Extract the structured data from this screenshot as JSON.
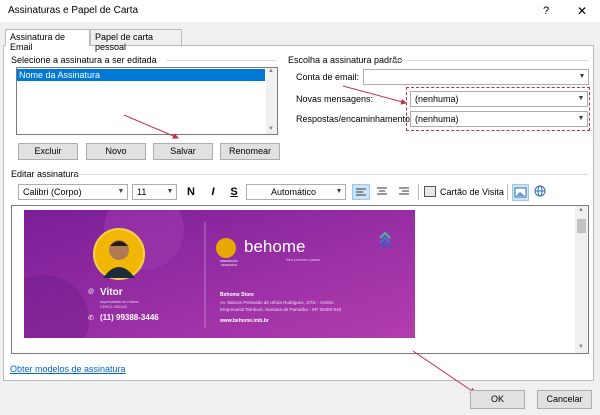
{
  "window": {
    "title": "Assinaturas e Papel de Carta",
    "help": "?",
    "close": "✕"
  },
  "tabs": [
    {
      "label": "Assinatura de Email"
    },
    {
      "label": "Papel de carta pessoal"
    }
  ],
  "left_group": {
    "label": "Selecione a assinatura a ser editada",
    "items": [
      "Nome da Assinatura"
    ],
    "buttons": {
      "delete": "Excluir",
      "new": "Novo",
      "save": "Salvar",
      "rename": "Renomear"
    }
  },
  "right_group": {
    "label": "Escolha a assinatura padrão",
    "account_label": "Conta de email:",
    "account_value": "",
    "new_messages_label": "Novas mensagens:",
    "new_messages_value": "(nenhuma)",
    "replies_label": "Respostas/encaminhamentos:",
    "replies_value": "(nenhuma)"
  },
  "editor": {
    "label": "Editar assinatura",
    "font": "Calibri (Corpo)",
    "size": "11",
    "bold": "N",
    "italic": "I",
    "underline": "S",
    "color": "Automático",
    "business_card": "Cartão de Visita"
  },
  "signature": {
    "name": "Vitor",
    "subtitle": "especialista em home",
    "subtitle2": "CRECI 202442",
    "phone": "(11) 99388-3446",
    "brand": "behome",
    "brand_tagline": "Seu próximo passo",
    "badge": "PREMIAÇÃO DIAMANTE",
    "company": "Behome Store",
    "address1": "Av. Marcos Penteado de Ulhôa Rodrigues, 3701 - Centro",
    "address2": "Empresarial Tamboré, Santana de Parnaíba - SP, 06460-040",
    "website": "www.behome.imb.br"
  },
  "footer": {
    "templates_link": "Obter modelos de assinatura",
    "ok": "OK",
    "cancel": "Cancelar"
  },
  "colors": {
    "accent": "#0078d7",
    "signature_bg": "#8f2aa0",
    "highlight_dash": "#c0304a",
    "arrow": "#c0304a"
  }
}
